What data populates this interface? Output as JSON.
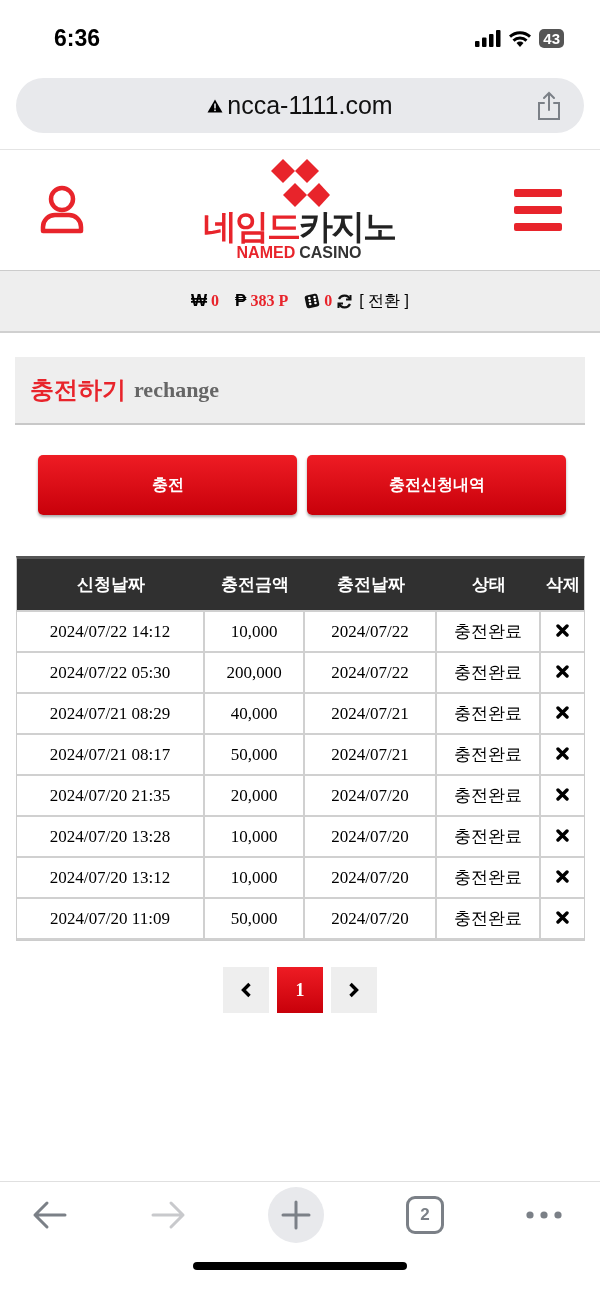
{
  "status_bar": {
    "time": "6:36",
    "battery": "43"
  },
  "browser": {
    "url": "ncca-1111.com",
    "tab_count": "2"
  },
  "logo": {
    "korean_red": "네임드",
    "korean_dark": "카지노",
    "english_red": "NAMED",
    "english_dark": "CASINO"
  },
  "balance": {
    "won_symbol": "₩",
    "won": "0",
    "point_symbol": "₱",
    "points": "383 P",
    "chips": "0",
    "switch": "[ 전환 ]"
  },
  "section": {
    "title": "충전하기",
    "subtitle": "rechange"
  },
  "buttons": [
    "충전",
    "충전신청내역"
  ],
  "table": {
    "columns": [
      "신청날짜",
      "충전금액",
      "충전날짜",
      "상태",
      "삭제"
    ],
    "rows": [
      {
        "requested": "2024/07/22 14:12",
        "amount": "10,000",
        "charged": "2024/07/22",
        "status": "충전완료"
      },
      {
        "requested": "2024/07/22 05:30",
        "amount": "200,000",
        "charged": "2024/07/22",
        "status": "충전완료"
      },
      {
        "requested": "2024/07/21 08:29",
        "amount": "40,000",
        "charged": "2024/07/21",
        "status": "충전완료"
      },
      {
        "requested": "2024/07/21 08:17",
        "amount": "50,000",
        "charged": "2024/07/21",
        "status": "충전완료"
      },
      {
        "requested": "2024/07/20 21:35",
        "amount": "20,000",
        "charged": "2024/07/20",
        "status": "충전완료"
      },
      {
        "requested": "2024/07/20 13:28",
        "amount": "10,000",
        "charged": "2024/07/20",
        "status": "충전완료"
      },
      {
        "requested": "2024/07/20 13:12",
        "amount": "10,000",
        "charged": "2024/07/20",
        "status": "충전완료"
      },
      {
        "requested": "2024/07/20 11:09",
        "amount": "50,000",
        "charged": "2024/07/20",
        "status": "충전완료"
      }
    ]
  },
  "pagination": {
    "pages": [
      {
        "label": "1",
        "selected": true
      }
    ]
  }
}
